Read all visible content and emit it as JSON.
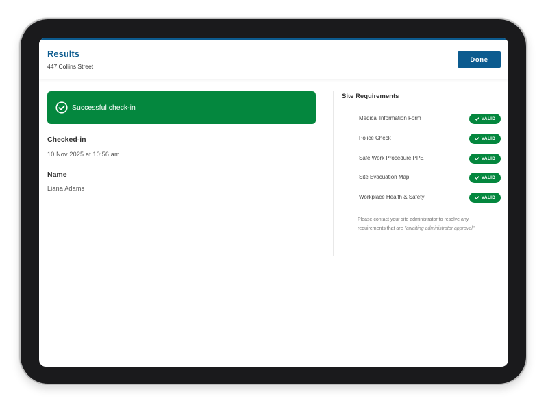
{
  "header": {
    "title": "Results",
    "subtitle": "447 Collins Street",
    "done_label": "Done"
  },
  "status": {
    "message": "Successful check-in",
    "icon": "check-circle-icon",
    "color": "#04873e"
  },
  "checked_in": {
    "label": "Checked-in",
    "value": "10 Nov 2025 at 10:56 am"
  },
  "name": {
    "label": "Name",
    "value": "Liana Adams"
  },
  "requirements": {
    "title": "Site Requirements",
    "items": [
      {
        "label": "Medical Information Form",
        "status": "VALID"
      },
      {
        "label": "Police Check",
        "status": "VALID"
      },
      {
        "label": "Safe Work Procedure PPE",
        "status": "VALID"
      },
      {
        "label": "Site Evacuation Map",
        "status": "VALID"
      },
      {
        "label": "Workplace Health & Safety",
        "status": "VALID"
      }
    ],
    "note_prefix": "Please contact your site administrator to resolve any requirements that are ",
    "note_emphasis": "\"awaiting administrator approval\"",
    "note_suffix": "."
  },
  "colors": {
    "brand_blue": "#0c5b8f",
    "valid_green": "#04873e"
  }
}
